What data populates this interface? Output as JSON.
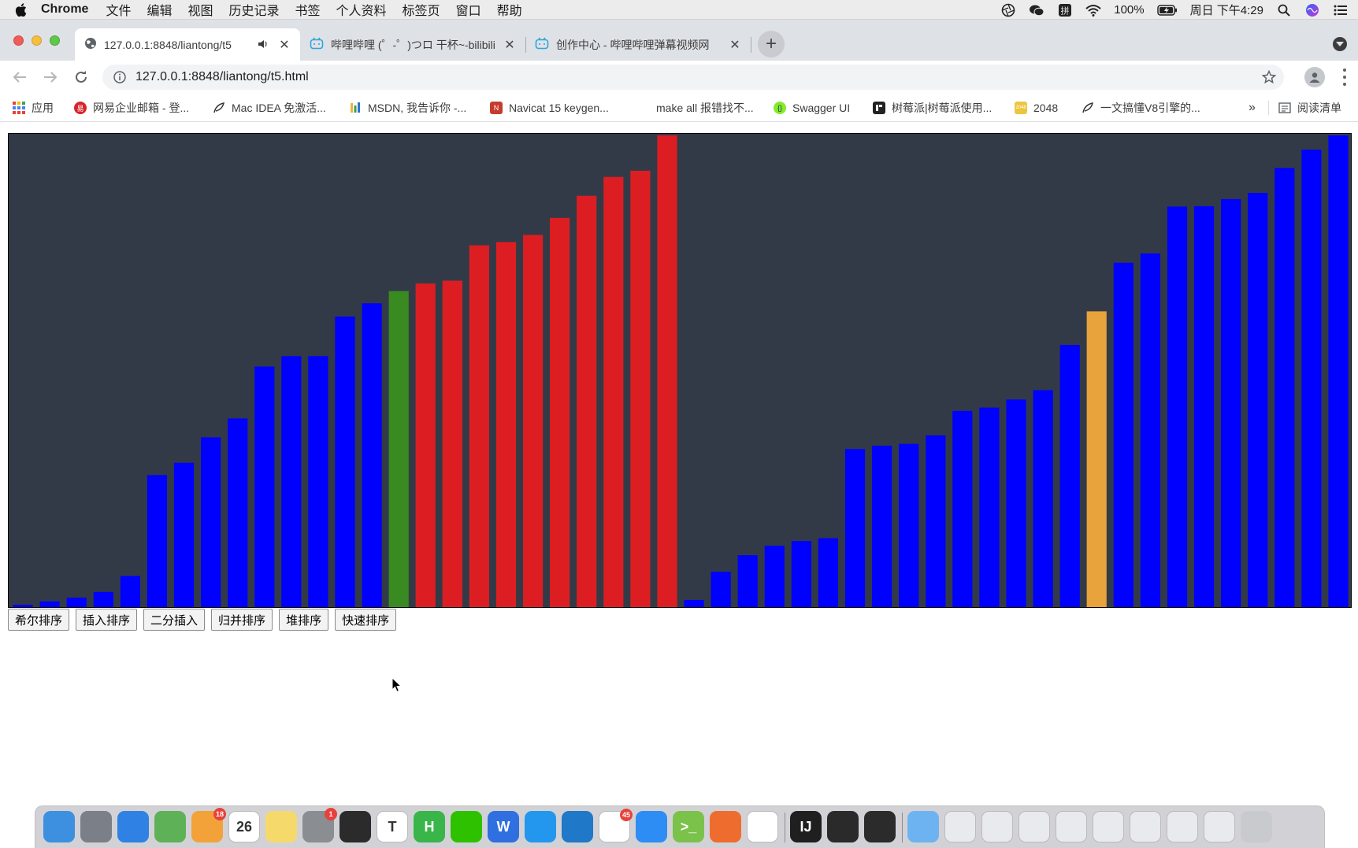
{
  "menubar": {
    "app": "Chrome",
    "items": [
      "文件",
      "编辑",
      "视图",
      "历史记录",
      "书签",
      "个人资料",
      "标签页",
      "窗口",
      "帮助"
    ],
    "battery": "100%",
    "clock": "周日 下午4:29"
  },
  "tabs": [
    {
      "title": "127.0.0.1:8848/liantong/t5",
      "active": true
    },
    {
      "title": "哔哩哔哩 (゜-゜)つロ 干杯~-bilibili",
      "active": false
    },
    {
      "title": "创作中心 - 哔哩哔哩弹幕视频网",
      "active": false
    }
  ],
  "address": {
    "url": "127.0.0.1:8848/liantong/t5.html"
  },
  "bookmarks": [
    {
      "label": "应用",
      "icon": "apps-grid-icon"
    },
    {
      "label": "网易企业邮箱 - 登...",
      "icon": "netease-mail-icon"
    },
    {
      "label": "Mac IDEA 免激活...",
      "icon": "feather-icon"
    },
    {
      "label": "MSDN, 我告诉你 -...",
      "icon": "msdn-icon"
    },
    {
      "label": "Navicat 15 keygen...",
      "icon": "navicat-icon"
    },
    {
      "label": "make all 报错找不...",
      "icon": ""
    },
    {
      "label": "Swagger UI",
      "icon": "swagger-icon"
    },
    {
      "label": "树莓派|树莓派使用...",
      "icon": "raspberry-icon"
    },
    {
      "label": "2048",
      "icon": "game-2048-icon"
    },
    {
      "label": "一文搞懂V8引擎的...",
      "icon": "feather-icon"
    }
  ],
  "bookmarks_overflow": "»",
  "reading_list": "阅读清单",
  "chart_data": {
    "type": "bar",
    "ylim": [
      0,
      100
    ],
    "grid": false,
    "colors": {
      "background": "#333a47",
      "default": "#0000ff",
      "sorted": "#dc1e23",
      "current": "#3a8a22",
      "pivot": "#e8a33c"
    },
    "values": [
      0.5,
      1.2,
      2,
      3.2,
      6.6,
      28,
      30.6,
      36,
      40,
      51,
      53.2,
      53.2,
      61.6,
      64.4,
      67,
      68.6,
      69.2,
      76.7,
      77.4,
      78.9,
      82.5,
      87.2,
      91.2,
      92.5,
      100,
      1.5,
      7.5,
      11,
      13,
      14,
      14.6,
      33.5,
      34.2,
      34.6,
      36.4,
      41.6,
      42.3,
      44,
      46,
      55.6,
      62.7,
      73,
      75,
      84.9,
      85,
      86.5,
      87.8,
      93.1,
      97,
      100
    ],
    "states": [
      "default",
      "default",
      "default",
      "default",
      "default",
      "default",
      "default",
      "default",
      "default",
      "default",
      "default",
      "default",
      "default",
      "default",
      "current",
      "sorted",
      "sorted",
      "sorted",
      "sorted",
      "sorted",
      "sorted",
      "sorted",
      "sorted",
      "sorted",
      "sorted",
      "default",
      "default",
      "default",
      "default",
      "default",
      "default",
      "default",
      "default",
      "default",
      "default",
      "default",
      "default",
      "default",
      "default",
      "default",
      "pivot",
      "default",
      "default",
      "default",
      "default",
      "default",
      "default",
      "default",
      "default",
      "default"
    ]
  },
  "buttons": [
    "希尔排序",
    "插入排序",
    "二分插入",
    "归并排序",
    "堆排序",
    "快速排序"
  ],
  "dock": {
    "icons": [
      {
        "name": "finder-icon",
        "color": "#3d8fe0",
        "label": ""
      },
      {
        "name": "launchpad-icon",
        "color": "#7a7f88",
        "label": ""
      },
      {
        "name": "safari-icon",
        "color": "#2f82e3",
        "label": ""
      },
      {
        "name": "maps-icon",
        "color": "#5fb157",
        "label": ""
      },
      {
        "name": "photos-icon",
        "color": "#f3a23a",
        "label": "",
        "badge": "18"
      },
      {
        "name": "calendar-icon",
        "color": "#ffffff",
        "label": "26"
      },
      {
        "name": "notes-icon",
        "color": "#f6d96b",
        "label": ""
      },
      {
        "name": "system-preferences-icon",
        "color": "#8a8d92",
        "label": "",
        "badge": "1"
      },
      {
        "name": "terminal-icon",
        "color": "#2b2b2b",
        "label": ""
      },
      {
        "name": "typora-icon",
        "color": "#ffffff",
        "label": "T"
      },
      {
        "name": "hbuilder-icon",
        "color": "#39b54a",
        "label": "H"
      },
      {
        "name": "wechat-icon",
        "color": "#2dc100",
        "label": ""
      },
      {
        "name": "wps-icon",
        "color": "#2f6fe0",
        "label": "W"
      },
      {
        "name": "docker-icon",
        "color": "#2396ed",
        "label": ""
      },
      {
        "name": "vscode-icon",
        "color": "#1f78c8",
        "label": ""
      },
      {
        "name": "qq-icon",
        "color": "#ffffff",
        "label": "",
        "badge": "45"
      },
      {
        "name": "app-store-icon",
        "color": "#2e8df5",
        "label": ""
      },
      {
        "name": "ssh-terminal-icon",
        "color": "#7bc24b",
        "label": ">_"
      },
      {
        "name": "postman-icon",
        "color": "#ef6c2f",
        "label": ""
      },
      {
        "name": "chrome-icon",
        "color": "#ffffff",
        "label": ""
      },
      {
        "name": "intellij-icon",
        "color": "#1f1f1f",
        "label": "IJ"
      },
      {
        "name": "quicktime-icon",
        "color": "#2a2a2a",
        "label": ""
      },
      {
        "name": "obs-icon",
        "color": "#2b2b2b",
        "label": ""
      },
      {
        "name": "folder-icon",
        "color": "#6db3f2",
        "label": ""
      },
      {
        "name": "screenshot-thumb-icon",
        "color": "#e8eaee",
        "label": ""
      },
      {
        "name": "screenshot-thumb-icon",
        "color": "#e8eaee",
        "label": ""
      },
      {
        "name": "screenshot-thumb-icon",
        "color": "#e8eaee",
        "label": ""
      },
      {
        "name": "screenshot-thumb-icon",
        "color": "#e8eaee",
        "label": ""
      },
      {
        "name": "screenshot-thumb-icon",
        "color": "#e8eaee",
        "label": ""
      },
      {
        "name": "screenshot-thumb-icon",
        "color": "#e8eaee",
        "label": ""
      },
      {
        "name": "screenshot-thumb-icon",
        "color": "#e8eaee",
        "label": ""
      },
      {
        "name": "screenshot-thumb-icon",
        "color": "#e8eaee",
        "label": ""
      },
      {
        "name": "trash-icon",
        "color": "#c8cace",
        "label": ""
      }
    ]
  }
}
